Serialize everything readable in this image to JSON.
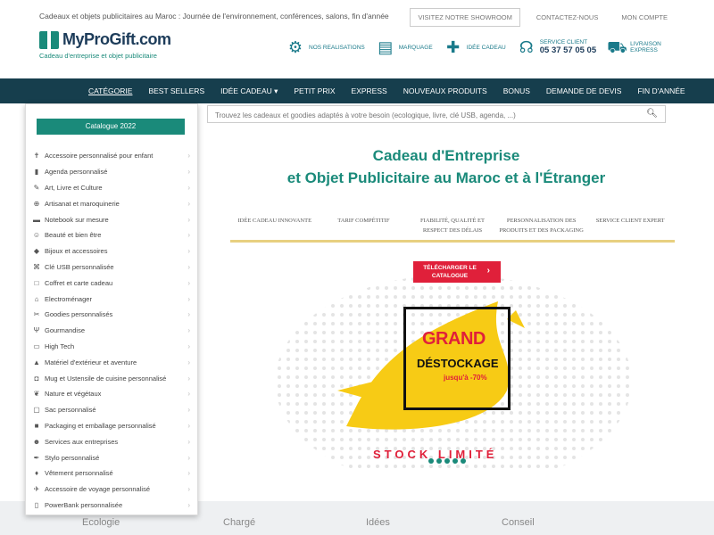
{
  "header": {
    "tagline": "Cadeaux et objets publicitaires au Maroc : Journée de l'environnement, conférences, salons, fin d'année",
    "links": [
      "VISITEZ NOTRE SHOWROOM",
      "CONTACTEZ-NOUS",
      "MON COMPTE"
    ],
    "logo": "MyProGift.com",
    "logo_sub": "Cadeau d'entreprise et objet publicitaire",
    "items": [
      {
        "label": "NOS REALISATIONS",
        "icon": "gears-icon"
      },
      {
        "label": "MARQUAGE",
        "icon": "clipboard-icon"
      },
      {
        "label": "IDÉE CADEAU",
        "icon": "gift-icon"
      },
      {
        "label": "SERVICE CLIENT",
        "phone": "05 37 57 05 05",
        "icon": "headset-icon"
      },
      {
        "label": "LIVRAISON EXPRESS",
        "icon": "truck-icon"
      }
    ]
  },
  "nav": [
    "CATÉGORIE",
    "BEST SELLERS",
    "IDÉE CADEAU ▾",
    "PETIT PRIX",
    "EXPRESS",
    "NOUVEAUX PRODUITS",
    "BONUS",
    "DEMANDE DE DEVIS",
    "FIN D'ANNÉE"
  ],
  "search": {
    "placeholder": "Trouvez les cadeaux et goodies adaptés à votre besoin (ecologique, livre, clé USB, agenda, ...)"
  },
  "dropdown": {
    "button": "Catalogue 2022",
    "categories": [
      "Accessoire personnalisé pour enfant",
      "Agenda personnalisé",
      "Art, Livre et Culture",
      "Artisanat et maroquinerie",
      "Notebook sur mesure",
      "Beauté et bien être",
      "Bijoux et accessoires",
      "Clé USB personnalisée",
      "Coffret et carte cadeau",
      "Electroménager",
      "Goodies personnalisés",
      "Gourmandise",
      "High Tech",
      "Matériel d'extérieur et aventure",
      "Mug et Ustensile de cuisine personnalisé",
      "Nature et végétaux",
      "Sac personnalisé",
      "Packaging et emballage personnalisé",
      "Services aux entreprises",
      "Stylo personnalisé",
      "Vêtement personnalisé",
      "Accessoire de voyage personnalisé",
      "PowerBank personnalisée"
    ]
  },
  "main": {
    "title_line1": "Cadeau d'Entreprise",
    "title_line2": "et Objet Publicitaire au Maroc et à l'Étranger",
    "features": [
      "IDÉE CADEAU INNOVANTE",
      "TARIF COMPÉTITIF",
      "FIABILITÉ, QUALITÉ ET RESPECT DES DÉLAIS",
      "PERSONNALISATION DES PRODUITS ET DES PACKAGING",
      "SERVICE CLIENT EXPERT"
    ],
    "download": "TÉLÉCHARGER LE CATALOGUE",
    "promo_grand": "GRAND",
    "promo_destockage": "DÉSTOCKAGE",
    "promo_jusqua": "jusqu'à -70%",
    "stock": "STOCK LIMITÉ"
  },
  "footer": [
    "Ecologie",
    "Chargé",
    "Idées",
    "Conseil"
  ]
}
